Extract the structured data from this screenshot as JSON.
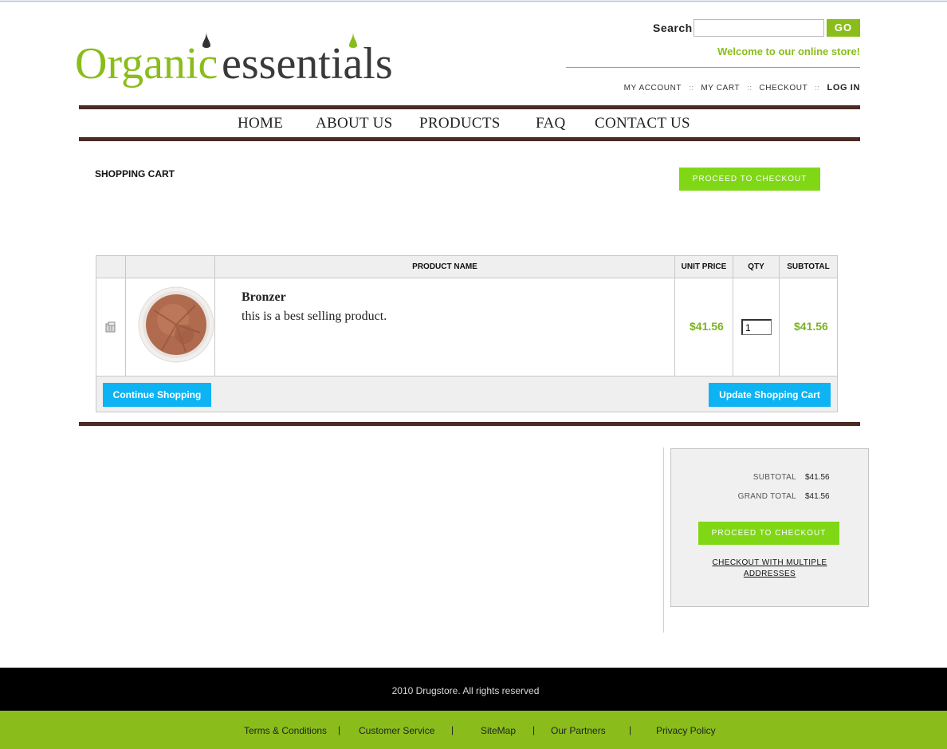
{
  "brand": {
    "logo_organic": "Organic",
    "logo_essentials": "essentials",
    "logo_letter_e": "E",
    "accent_green": "#8abd1b",
    "dark_brown": "#4a2b25",
    "button_blue": "#0db3f3"
  },
  "header": {
    "search_label": "Search",
    "search_value": "",
    "go_label": "GO",
    "welcome": "Welcome to our online store!",
    "links": {
      "my_account": "MY ACCOUNT",
      "my_cart": "MY CART",
      "checkout": "CHECKOUT",
      "login": "LOG IN",
      "separator": "::"
    }
  },
  "nav": {
    "home": "HOME",
    "about": "ABOUT US",
    "products": "PRODUCTS",
    "faq": "FAQ",
    "contact": "CONTACT US"
  },
  "cart": {
    "title": "SHOPPING CART",
    "proceed_label": "PROCEED TO CHECKOUT",
    "columns": {
      "product_name": "PRODUCT NAME",
      "unit_price": "UNIT PRICE",
      "qty": "QTY",
      "subtotal": "SUBTOTAL"
    },
    "items": [
      {
        "name": "Bronzer",
        "description": "this is a best selling product.",
        "unit_price": "$41.56",
        "qty": "1",
        "subtotal": "$41.56",
        "remove_icon": "trash-icon",
        "image_icon": "bronzer-powder-image"
      }
    ],
    "continue_label": "Continue Shopping",
    "update_label": "Update Shopping Cart"
  },
  "totals": {
    "subtotal_label": "SUBTOTAL",
    "subtotal_value": "$41.56",
    "grand_total_label": "GRAND TOTAL",
    "grand_total_value": "$41.56",
    "proceed_label": "PROCEED TO CHECKOUT",
    "multi_line1": "CHECKOUT WITH MULTIPLE",
    "multi_line2": "ADDRESSES"
  },
  "footer": {
    "copyright": "2010 Drugstore. All rights reserved",
    "links": {
      "terms": "Terms & Conditions",
      "service": "Customer Service",
      "sitemap": "SiteMap",
      "partners": "Our Partners",
      "privacy": "Privacy Policy",
      "separator": "|"
    }
  }
}
